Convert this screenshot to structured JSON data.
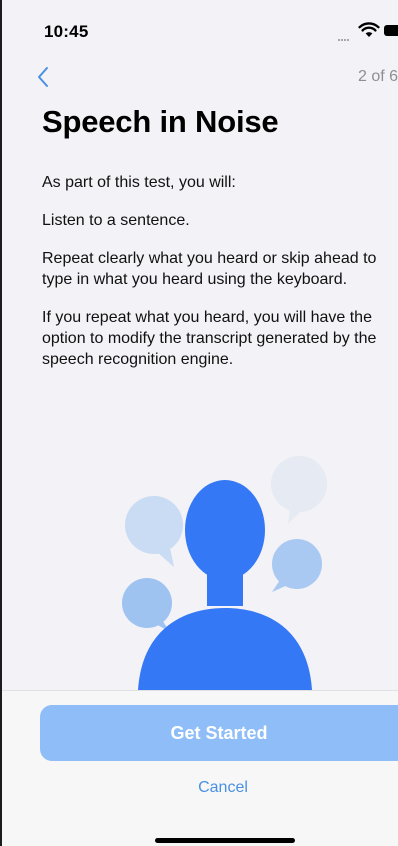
{
  "status_bar": {
    "time": "10:45"
  },
  "nav": {
    "back_label": "<",
    "step": "2 of 6"
  },
  "title": "Speech in Noise",
  "intro": "As part of this test, you will:",
  "steps": [
    "Listen to a sentence.",
    "Repeat clearly what you heard or skip ahead to type in what you heard using the keyboard.",
    "If you repeat what you heard, you will have the option to modify the transcript generated by the speech recognition engine."
  ],
  "actions": {
    "primary": "Get Started",
    "secondary": "Cancel"
  },
  "colors": {
    "accent": "#4a90e2",
    "button_fill": "#8fbdf7",
    "figure": "#3478f6",
    "bubble_light": "#dfe5ef",
    "bubble_mid": "#b9d3f5",
    "bubble_strong": "#9ec3f1"
  }
}
